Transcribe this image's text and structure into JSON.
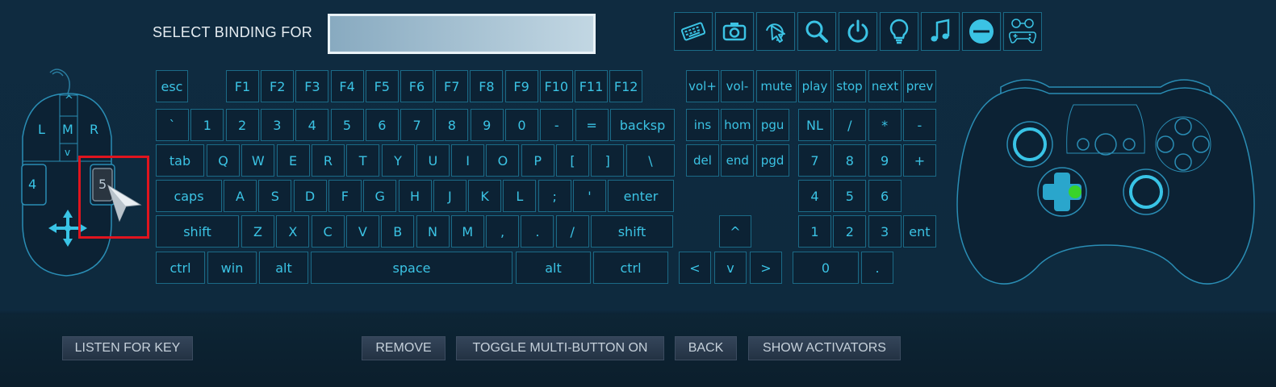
{
  "header": {
    "select_label": "SELECT BINDING FOR",
    "binding_value": ""
  },
  "toolbar_icons": [
    "keyboard-icon",
    "camera-icon",
    "mouse-click-icon",
    "magnifier-icon",
    "power-icon",
    "lightbulb-icon",
    "music-note-icon",
    "minus-circle-icon",
    "controller-buttons-icon"
  ],
  "mouse": {
    "left": "L",
    "middle": "M",
    "right": "R",
    "wheel_up": "^",
    "wheel_down": "v",
    "button4": "4",
    "button5": "5"
  },
  "keyboard": {
    "fn_row": [
      "esc",
      "F1",
      "F2",
      "F3",
      "F4",
      "F5",
      "F6",
      "F7",
      "F8",
      "F9",
      "F10",
      "F11",
      "F12"
    ],
    "number_row": [
      "`",
      "1",
      "2",
      "3",
      "4",
      "5",
      "6",
      "7",
      "8",
      "9",
      "0",
      "-",
      "=",
      "backsp"
    ],
    "tab_row": [
      "tab",
      "Q",
      "W",
      "E",
      "R",
      "T",
      "Y",
      "U",
      "I",
      "O",
      "P",
      "[",
      "]",
      "\\"
    ],
    "caps_row": [
      "caps",
      "A",
      "S",
      "D",
      "F",
      "G",
      "H",
      "J",
      "K",
      "L",
      ";",
      "'",
      "enter"
    ],
    "shift_row": [
      "shift",
      "Z",
      "X",
      "C",
      "V",
      "B",
      "N",
      "M",
      ",",
      ".",
      "/",
      "shift"
    ],
    "bottom_row": [
      "ctrl",
      "win",
      "alt",
      "space",
      "alt",
      "ctrl"
    ]
  },
  "media_keys": [
    "vol+",
    "vol-",
    "mute",
    "play",
    "stop",
    "next",
    "prev"
  ],
  "nav_keys": [
    "ins",
    "hom",
    "pgu",
    "del",
    "end",
    "pgd"
  ],
  "arrows": {
    "up": "^",
    "left": "<",
    "down": "v",
    "right": ">"
  },
  "numpad": {
    "row1": [
      "NL",
      "/",
      "*",
      "-"
    ],
    "row2": [
      "7",
      "8",
      "9",
      "+"
    ],
    "row3": [
      "4",
      "5",
      "6"
    ],
    "row4": [
      "1",
      "2",
      "3",
      "ent"
    ],
    "row5": [
      "0",
      "."
    ]
  },
  "buttons": {
    "listen": "LISTEN FOR KEY",
    "remove": "REMOVE",
    "toggle": "TOGGLE MULTI-BUTTON ON",
    "back": "BACK",
    "activators": "SHOW ACTIVATORS"
  },
  "colors": {
    "accent": "#39c4e6",
    "highlight": "#e0141e",
    "dpad_active": "#39d32a"
  }
}
